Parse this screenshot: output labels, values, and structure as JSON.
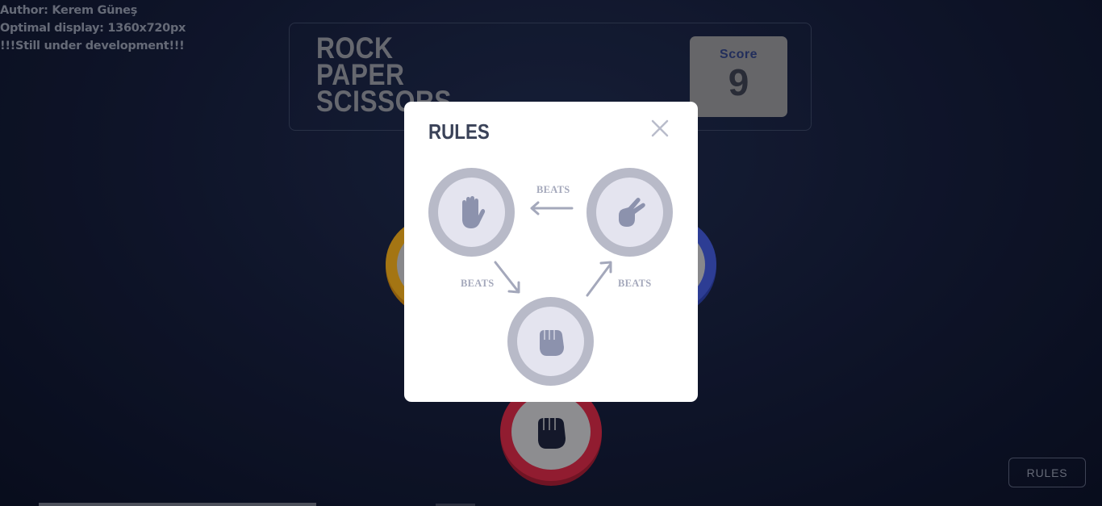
{
  "author": {
    "line1": "Author: Kerem Güneş",
    "line2": "Optimal display: 1360x720px",
    "line3": "!!!Still under development!!!"
  },
  "header": {
    "logo_lines": [
      "ROCK",
      "PAPER",
      "SCISSORS"
    ],
    "score_label": "Score",
    "score_value": "9"
  },
  "game_tokens": [
    {
      "name": "paper",
      "ring_color": "#e3a217"
    },
    {
      "name": "scissors",
      "ring_color": "#3f55c9"
    },
    {
      "name": "rock",
      "ring_color": "#c9283f"
    }
  ],
  "rules_button": {
    "label": "RULES"
  },
  "modal": {
    "title": "RULES",
    "close_icon": "close-icon",
    "beats_labels": [
      "BEATS",
      "BEATS",
      "BEATS"
    ],
    "tokens": [
      "paper-icon",
      "scissors-icon",
      "rock-icon"
    ]
  }
}
